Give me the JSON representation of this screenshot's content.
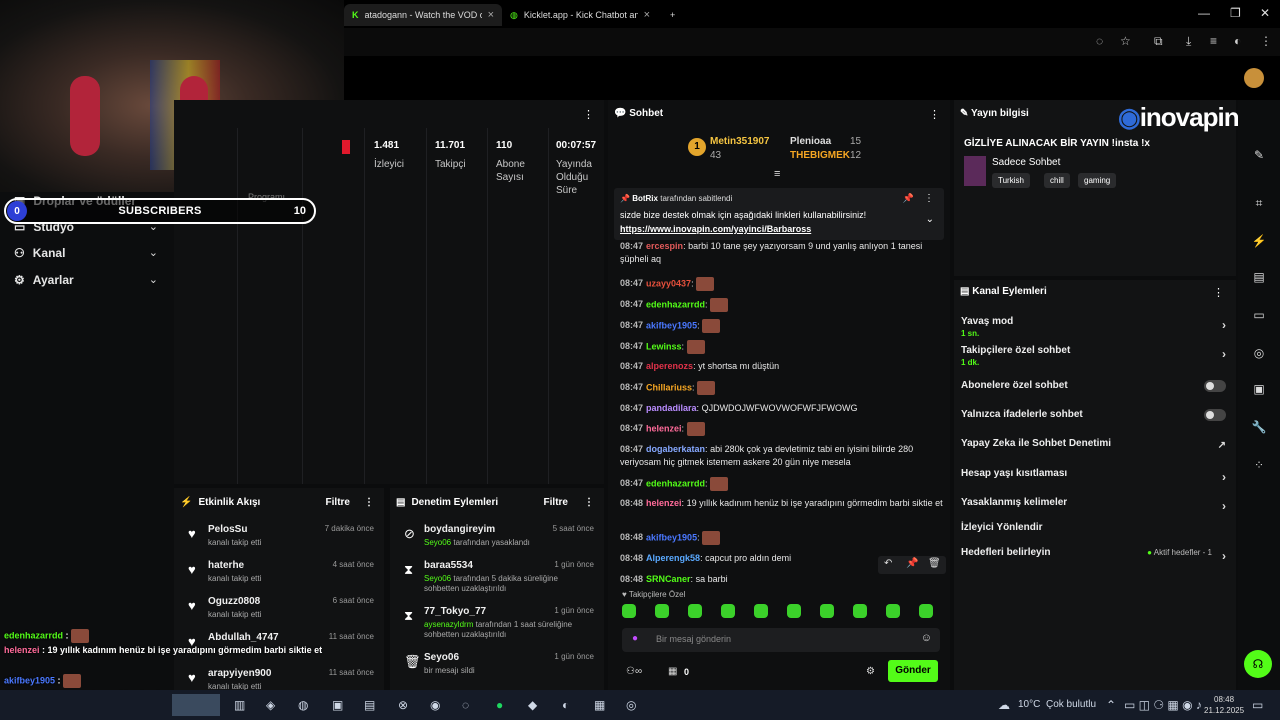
{
  "browser": {
    "tab1": "atadogann - Watch the VOD or",
    "tab2": "Kicklet.app - Kick Chatbot and",
    "close": "×",
    "new_tab": "+",
    "min": "—",
    "max": "❐",
    "win_close": "✕"
  },
  "subscribers": {
    "current": "0",
    "label": "SUBSCRIBERS",
    "goal": "10"
  },
  "left_nav": {
    "drops": "Droplar ve ödüller",
    "studio": "Stüdyo",
    "channel": "Kanal",
    "settings": "Ayarlar",
    "program": "Programı"
  },
  "stats": [
    {
      "value": "1.481",
      "label": "İzleyici"
    },
    {
      "value": "11.701",
      "label": "Takipçi"
    },
    {
      "value": "110",
      "label": "Abone Sayısı"
    },
    {
      "value": "00:07:57",
      "label": "Yayında Olduğu Süre"
    }
  ],
  "activity": {
    "title": "Etkinlik Akışı",
    "filter": "Filtre",
    "items": [
      {
        "name": "PelosSu",
        "sub": "kanalı takip etti",
        "time": "7 dakika önce"
      },
      {
        "name": "haterhe",
        "sub": "kanalı takip etti",
        "time": "4 saat önce"
      },
      {
        "name": "Oguzz0808",
        "sub": "kanalı takip etti",
        "time": "6 saat önce"
      },
      {
        "name": "Abdullah_4747",
        "sub": "",
        "time": "11 saat önce"
      },
      {
        "name": "arapyiyen900",
        "sub": "kanalı takip etti",
        "time": "11 saat önce"
      }
    ]
  },
  "moderation": {
    "title": "Denetim Eylemleri",
    "filter": "Filtre",
    "items": [
      {
        "name": "boydangireyim",
        "by": "Seyo06",
        "sub": "tarafından yasaklandı",
        "time": "5 saat önce"
      },
      {
        "name": "baraa5534",
        "by": "Seyo06",
        "sub": "tarafından 5 dakika süreliğine sohbetten uzaklaştırıldı",
        "time": "1 gün önce"
      },
      {
        "name": "77_Tokyo_77",
        "by": "aysenazyldrm",
        "sub": "tarafından 1 saat süreliğine sohbetten uzaklaştırıldı",
        "time": "1 gün önce"
      },
      {
        "name": "Seyo06",
        "by": "",
        "sub": "bir mesajı sildi",
        "time": "1 gün önce"
      }
    ]
  },
  "chat": {
    "title": "Sohbet",
    "gifters": [
      {
        "rank": "1",
        "name": "Metin351907",
        "count": "43"
      },
      {
        "name": "Plenioaa",
        "count": "15"
      },
      {
        "name": "THEBIGMEK",
        "count": "12"
      }
    ],
    "pinned": {
      "by": "BotRix",
      "by_suffix": "tarafından sabitlendi",
      "text": "sizde bize destek olmak için aşağıdaki linkleri kullanabilirsiniz!",
      "link": "https://www.inovapin.com/yayinci/Barbaross"
    },
    "messages": [
      {
        "time": "08:47",
        "user": "ercespin",
        "color": "#e25a5a",
        "text": "barbi 10 tane şey yazıyorsam 9 und yanlış anlıyon 1 tanesi şüpheli aq"
      },
      {
        "time": "08:47",
        "user": "uzayy0437",
        "color": "#e6503c",
        "text": ""
      },
      {
        "time": "08:47",
        "user": "edenhazarrdd",
        "color": "#53fc18",
        "text": ""
      },
      {
        "time": "08:47",
        "user": "akifbey1905",
        "color": "#4a78ff",
        "text": ""
      },
      {
        "time": "08:47",
        "user": "Lewinss",
        "color": "#53fc18",
        "text": ""
      },
      {
        "time": "08:47",
        "user": "alperenozs",
        "color": "#e2324a",
        "text": "yt shortsa mı düştün"
      },
      {
        "time": "08:47",
        "user": "Chillariuss",
        "color": "#f5a623",
        "text": ""
      },
      {
        "time": "08:47",
        "user": "pandadilara",
        "color": "#b98cff",
        "text": "QJDWDOJWFWOVWOFWFJFWOWG"
      },
      {
        "time": "08:47",
        "user": "helenzei",
        "color": "#ff6b9a",
        "text": ""
      },
      {
        "time": "08:47",
        "user": "dogaberkatan",
        "color": "#86a8ff",
        "text": "abi 280k çok ya devletimiz tabi en iyisini bilirde 280 veriyosam hiç gitmek istemem askere 20 gün niye mesela"
      },
      {
        "time": "08:47",
        "user": "edenhazarrdd",
        "color": "#53fc18",
        "text": ""
      },
      {
        "time": "08:48",
        "user": "helenzei",
        "color": "#ff6b9a",
        "text": "19 yıllık kadınım henüz bi işe yaradıpını görmedim barbi siktie et"
      },
      {
        "time": "08:48",
        "user": "akifbey1905",
        "color": "#4a78ff",
        "text": ""
      },
      {
        "time": "08:48",
        "user": "Alperengk58",
        "color": "#5aa9ff",
        "text": "capcut pro aldın demi"
      },
      {
        "time": "08:48",
        "user": "SRNCaner",
        "color": "#53fc18",
        "text": "sa barbi"
      }
    ],
    "mode": "Takipçilere Özel",
    "input_placeholder": "Bir mesaj gönderin",
    "points": "0",
    "send": "Gönder"
  },
  "stream_info": {
    "header": "Yayın bilgisi",
    "title": "GİZLİYE ALINACAK BİR YAYIN !insta !x",
    "category": "Sadece Sohbet",
    "tags": [
      "Turkish",
      "chill",
      "gaming"
    ],
    "brand": "inovapin"
  },
  "channel_actions": {
    "header": "Kanal Eylemleri",
    "items": [
      {
        "label": "Yavaş mod",
        "sub": "1 sn."
      },
      {
        "label": "Takipçilere özel sohbet",
        "sub": "1 dk."
      },
      {
        "label": "Abonelere özel sohbet",
        "sub": ""
      },
      {
        "label": "Yalnızca ifadelerle sohbet",
        "sub": ""
      },
      {
        "label": "Yapay Zeka ile Sohbet Denetimi",
        "sub": ""
      },
      {
        "label": "Hesap yaşı kısıtlaması",
        "sub": ""
      },
      {
        "label": "Yasaklanmış kelimeler",
        "sub": ""
      },
      {
        "label": "İzleyici Yönlendir",
        "sub": ""
      },
      {
        "label": "Hedefleri belirleyin",
        "sub": ""
      }
    ],
    "goals_status": "Aktif hedefler - 1"
  },
  "overlay_chat": [
    {
      "user": "edenhazarrdd",
      "color": "#53fc18",
      "text": ""
    },
    {
      "user": "helenzei",
      "color": "#ff6b9a",
      "text": "19 yıllık kadınım henüz bi işe yaradıpını görmedim barbi siktie et"
    },
    {
      "user": "akifbey1905",
      "color": "#4a78ff",
      "text": ""
    },
    {
      "user": "Alperengk58",
      "color": "#5aa9ff",
      "text": "capcut pro aldın demi"
    },
    {
      "user": "SRNCaner",
      "color": "#5aa9ff",
      "text": "sa barbi"
    }
  ],
  "taskbar": {
    "weather": "10°C",
    "weather_desc": "Çok bulutlu",
    "time": "08:48",
    "date": "21.12.2025"
  }
}
